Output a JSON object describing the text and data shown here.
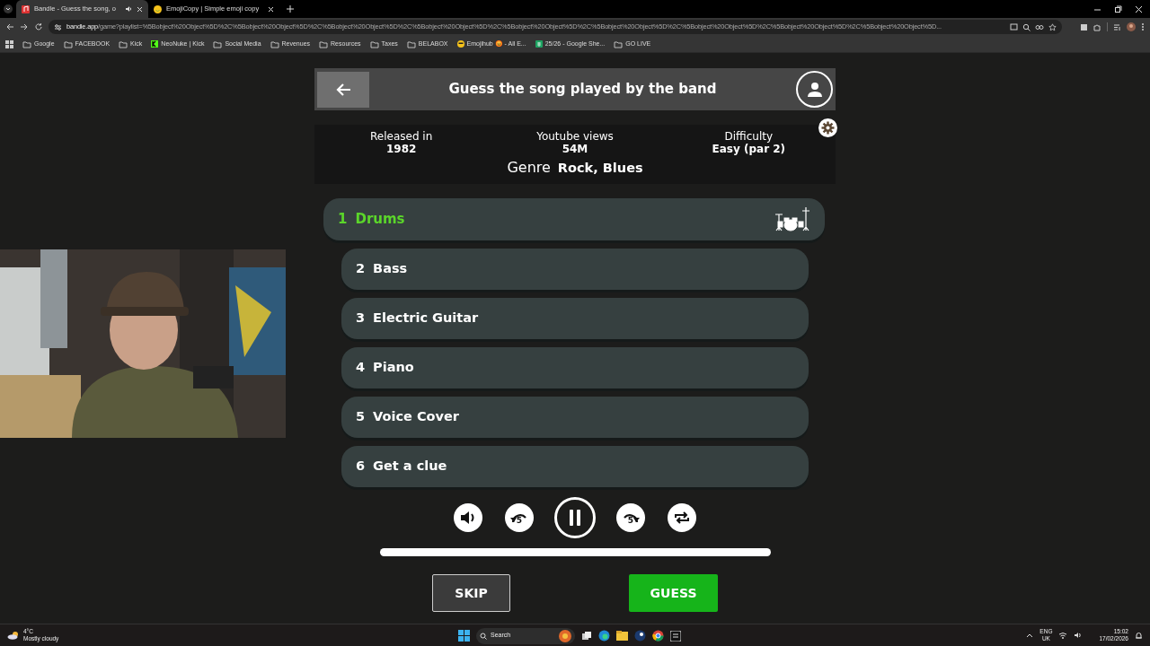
{
  "browser": {
    "tabs": [
      {
        "title": "Bandle - Guess the song, o",
        "selected": true,
        "audio": true,
        "kind": "bandle"
      },
      {
        "title": "EmojiCopy | Simple emoji copy",
        "selected": false,
        "audio": false,
        "kind": "emoji"
      }
    ],
    "address": {
      "host": "bandle.app",
      "path": "/game?playlist=%5Bobject%20Object%5D%2C%5Bobject%20Object%5D%2C%5Bobject%20Object%5D%2C%5Bobject%20Object%5D%2C%5Bobject%20Object%5D%2C%5Bobject%20Object%5D%2C%5Bobject%20Object%5D%2C%5Bobject%20Object%5D%2C%5Bobject%20Object%5D..."
    },
    "bookmarks": [
      {
        "label": "Google",
        "kind": "folder"
      },
      {
        "label": "FACEBOOK",
        "kind": "folder"
      },
      {
        "label": "Kick",
        "kind": "folder"
      },
      {
        "label": "NeoNuke | Kick",
        "kind": "kick"
      },
      {
        "label": "Social Media",
        "kind": "folder"
      },
      {
        "label": "Revenues",
        "kind": "folder"
      },
      {
        "label": "Resources",
        "kind": "folder"
      },
      {
        "label": "Taxes",
        "kind": "folder"
      },
      {
        "label": "BELABOX",
        "kind": "folder"
      },
      {
        "label": "Emojihub 😡 - All E...",
        "kind": "emoji"
      },
      {
        "label": "25/26 - Google She...",
        "kind": "sheet"
      },
      {
        "label": "GO LIVE",
        "kind": "folder"
      }
    ]
  },
  "game": {
    "title": "Guess the song played by the band",
    "info": [
      {
        "label": "Released in",
        "value": "1982"
      },
      {
        "label": "Youtube views",
        "value": "54M"
      },
      {
        "label": "Difficulty",
        "value": "Easy (par 2)"
      }
    ],
    "genre": {
      "label": "Genre",
      "value": "Rock, Blues"
    },
    "instruments": [
      {
        "number": "1",
        "name": "Drums",
        "selected": true
      },
      {
        "number": "2",
        "name": "Bass",
        "selected": false
      },
      {
        "number": "3",
        "name": "Electric Guitar",
        "selected": false
      },
      {
        "number": "4",
        "name": "Piano",
        "selected": false
      },
      {
        "number": "5",
        "name": "Voice Cover",
        "selected": false
      },
      {
        "number": "6",
        "name": "Get a clue",
        "selected": false
      }
    ],
    "player": {
      "rewind_seconds": "5",
      "forward_seconds": "5",
      "playing": true
    },
    "skip_label": "SKIP",
    "guess_label": "GUESS"
  },
  "taskbar": {
    "temperature": "4°C",
    "weather": "Mostly cloudy",
    "search": "Search",
    "language": "ENG",
    "region": "UK",
    "time": "15:02",
    "date": "17/02/2026"
  }
}
